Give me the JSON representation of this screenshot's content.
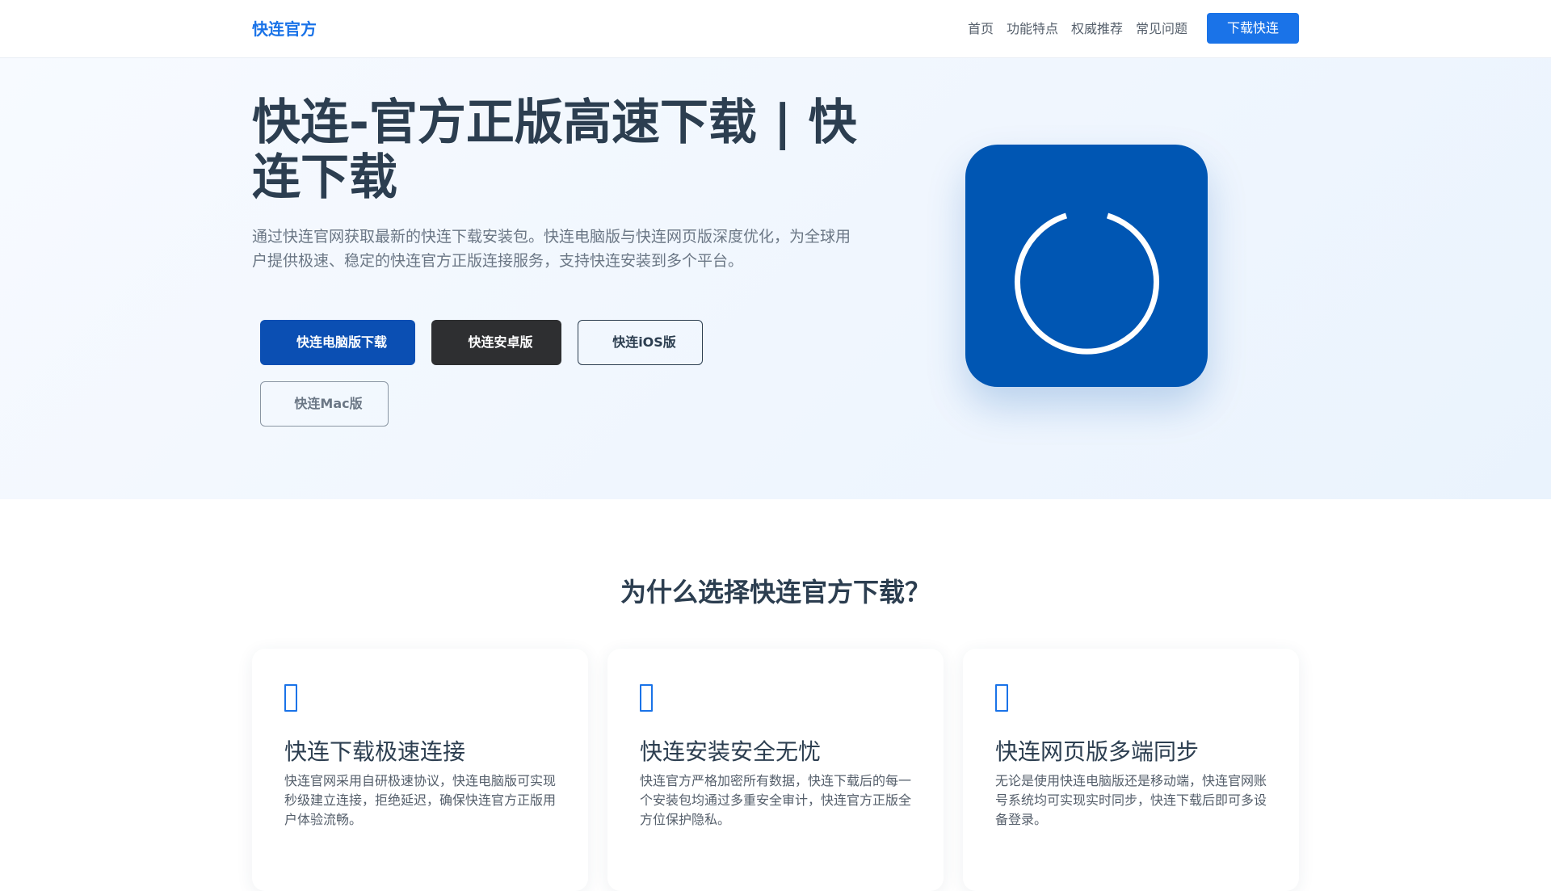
{
  "header": {
    "logo": "快连官方",
    "nav": [
      "首页",
      "功能特点",
      "权威推荐",
      "常见问题"
    ],
    "cta": "下载快连"
  },
  "hero": {
    "title": "快连-官方正版高速下载 | 快连下载",
    "description": "通过快连官网获取最新的快连下载安装包。快连电脑版与快连网页版深度优化，为全球用户提供极速、稳定的快连官方正版连接服务，支持快连安装到多个平台。",
    "buttons": {
      "pc": "快连电脑版下载",
      "android": "快连安卓版",
      "ios": "快连iOS版",
      "mac": "快连Mac版"
    },
    "button_icon": "",
    "app_icon": "power-ring-icon"
  },
  "features": {
    "title": "为什么选择快连官方下载？",
    "cards": [
      {
        "icon": "",
        "title": "快连下载极速连接",
        "text": "快连官网采用自研极速协议，快连电脑版可实现秒级建立连接，拒绝延迟，确保快连官方正版用户体验流畅。"
      },
      {
        "icon": "",
        "title": "快连安装安全无忧",
        "text": "快连官方严格加密所有数据，快连下载后的每一个安装包均通过多重安全审计，快连官方正版全方位保护隐私。"
      },
      {
        "icon": "",
        "title": "快连网页版多端同步",
        "text": "无论是使用快连电脑版还是移动端，快连官网账号系统均可实现实时同步，快连下载后即可多设备登录。"
      }
    ]
  },
  "colors": {
    "accent": "#1a73e8",
    "primary_button": "#0b4fb3",
    "dark_button": "#2e2f31",
    "app_icon_bg": "#0056b3",
    "heading": "#2c3e50"
  }
}
